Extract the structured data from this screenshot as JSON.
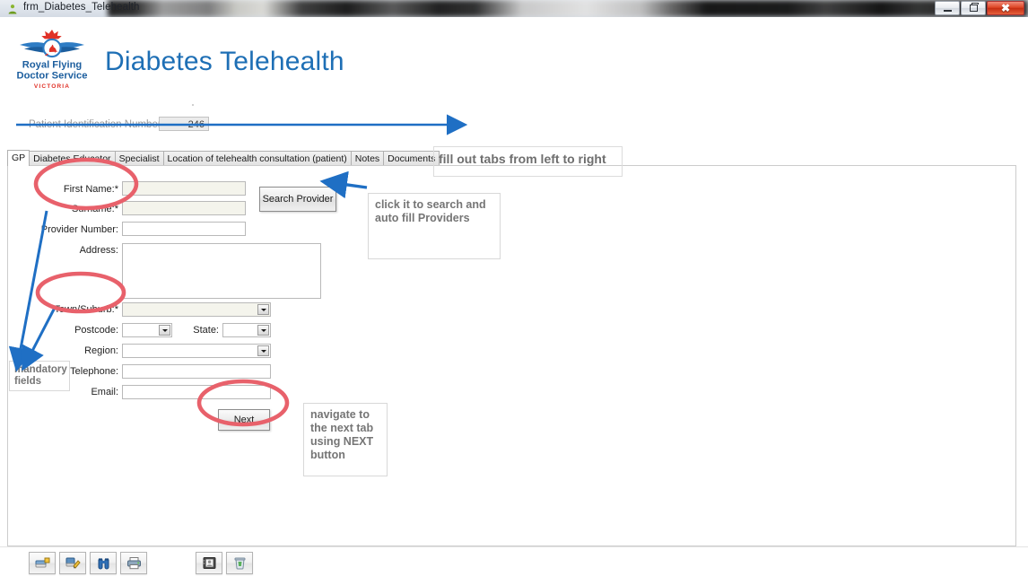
{
  "window": {
    "title": "frm_Diabetes_Telehealth",
    "app_icon": "person-icon",
    "controls": {
      "minimize": "minimize-icon",
      "restore": "restore-icon",
      "close": "close-icon"
    }
  },
  "header": {
    "app_title": "Diabetes Telehealth",
    "logo_alt": "Royal Flying Doctor Service Victoria",
    "logo_line1": "Royal Flying",
    "logo_line2": "Doctor Service",
    "logo_line3": "VICTORIA",
    "title_color": "#1e6fb5"
  },
  "patient": {
    "label": "Patient Identification Number:",
    "value": "246"
  },
  "tabs": [
    {
      "label": "GP",
      "active": true
    },
    {
      "label": "Diabetes Educator",
      "active": false
    },
    {
      "label": "Specialist",
      "active": false
    },
    {
      "label": "Location of telehealth consultation (patient)",
      "active": false
    },
    {
      "label": "Notes",
      "active": false
    },
    {
      "label": "Documents",
      "active": false
    }
  ],
  "form": {
    "fields": [
      {
        "label": "First Name:*",
        "type": "text",
        "value": "",
        "mandatory": true
      },
      {
        "label": "Surname:*",
        "type": "text",
        "value": "",
        "mandatory": true
      },
      {
        "label": "Provider Number:",
        "type": "text",
        "value": "",
        "mandatory": false
      },
      {
        "label": "Address:",
        "type": "textarea",
        "value": "",
        "mandatory": false
      },
      {
        "label": "Town/Suburb:*",
        "type": "combo",
        "value": "",
        "mandatory": true
      },
      {
        "label": "Postcode:",
        "type": "combo",
        "value": "",
        "mandatory": false
      },
      {
        "label": "State:",
        "type": "combo",
        "value": "",
        "mandatory": false
      },
      {
        "label": "Region:",
        "type": "combo",
        "value": "",
        "mandatory": false
      },
      {
        "label": "Telephone:",
        "type": "text",
        "value": "",
        "mandatory": false
      },
      {
        "label": "Email:",
        "type": "text",
        "value": "",
        "mandatory": false
      }
    ],
    "search_provider_button": "Search Provider",
    "next_button": "Next"
  },
  "annotations": {
    "tabs_order": "fill out tabs from left to right",
    "search_provider": "click it to search and auto fill Providers",
    "mandatory": "mandatory\nfields",
    "mandatory_line1": "mandatory",
    "mandatory_line2": "fields",
    "next": "navigate to\nthe next tab\nusing NEXT\nbutton",
    "next_line1": "navigate to",
    "next_line2": "the next tab",
    "next_line3": "using NEXT",
    "next_line4": "button",
    "arrow_color": "#1f6fc4",
    "ellipse_color": "#e8616b"
  },
  "toolbar": [
    {
      "name": "new-record-icon",
      "tooltip": "New Record"
    },
    {
      "name": "edit-record-icon",
      "tooltip": "Edit Record"
    },
    {
      "name": "find-binoculars-icon",
      "tooltip": "Find"
    },
    {
      "name": "print-icon",
      "tooltip": "Print"
    },
    {
      "name": "contacts-book-icon",
      "tooltip": "Contacts"
    },
    {
      "name": "delete-icon",
      "tooltip": "Delete"
    }
  ]
}
